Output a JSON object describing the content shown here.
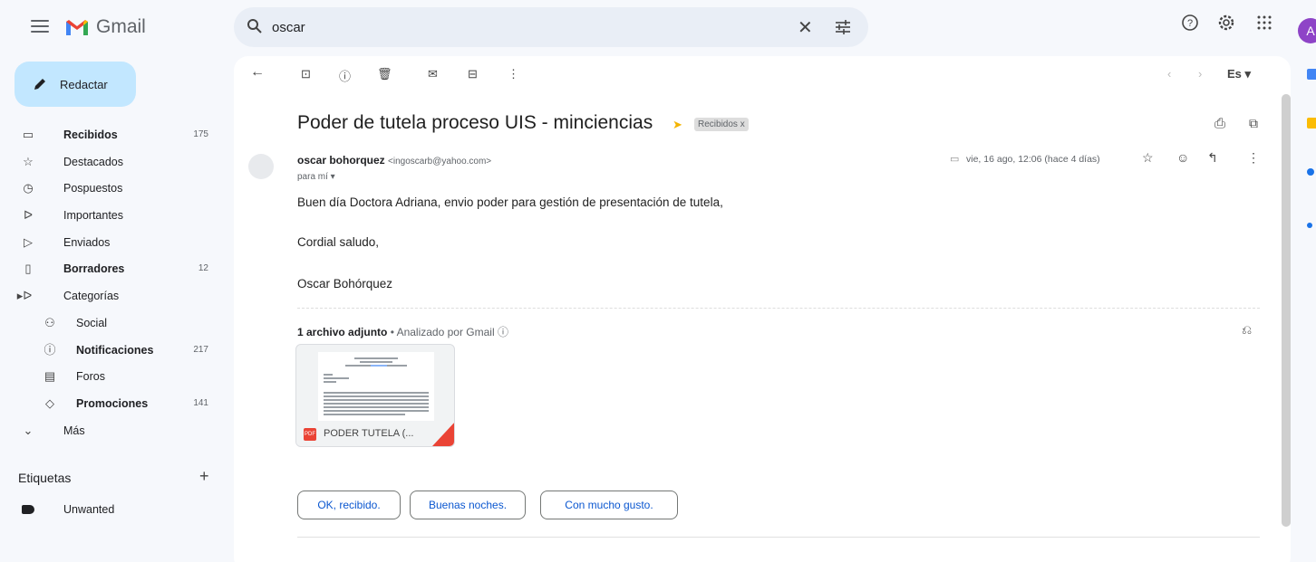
{
  "header": {
    "app_name": "Gmail",
    "search_value": "oscar",
    "avatar_letter": "A"
  },
  "compose_label": "Redactar",
  "sidebar": {
    "items": [
      {
        "label": "Recibidos",
        "count": "175",
        "icon": "inbox-icon",
        "bold": true
      },
      {
        "label": "Destacados",
        "count": "",
        "icon": "star-icon",
        "bold": false
      },
      {
        "label": "Pospuestos",
        "count": "",
        "icon": "clock-icon",
        "bold": false
      },
      {
        "label": "Importantes",
        "count": "",
        "icon": "important-icon",
        "bold": false
      },
      {
        "label": "Enviados",
        "count": "",
        "icon": "send-icon",
        "bold": false
      },
      {
        "label": "Borradores",
        "count": "12",
        "icon": "draft-icon",
        "bold": true
      },
      {
        "label": "Categorías",
        "count": "",
        "icon": "label-icon",
        "bold": false
      },
      {
        "label": "Social",
        "count": "",
        "icon": "people-icon",
        "bold": false
      },
      {
        "label": "Notificaciones",
        "count": "217",
        "icon": "info-icon",
        "bold": true
      },
      {
        "label": "Foros",
        "count": "",
        "icon": "forum-icon",
        "bold": false
      },
      {
        "label": "Promociones",
        "count": "141",
        "icon": "tag-icon",
        "bold": true
      },
      {
        "label": "Más",
        "count": "",
        "icon": "chevron-down-icon",
        "bold": false
      }
    ],
    "labels_heading": "Etiquetas",
    "labels": [
      {
        "label": "Unwanted"
      }
    ]
  },
  "toolbar": {
    "language": "Es"
  },
  "email": {
    "subject": "Poder de tutela proceso UIS - minciencias",
    "folder_chip": "Recibidos x",
    "sender_name": "oscar bohorquez",
    "sender_email": "<ingoscarb@yahoo.com>",
    "to": "para mí ▾",
    "date": "vie, 16 ago, 12:06 (hace 4 días)",
    "body": [
      "Buen día Doctora Adriana, envio poder para gestión de presentación de tutela,",
      "Cordial saludo,",
      "Oscar Bohórquez"
    ],
    "attachment_header": "1 archivo adjunto",
    "attachment_scan": "• Analizado por Gmail ⓘ",
    "attachment_name": "PODER TUTELA (...",
    "pdf_badge": "PDF"
  },
  "smart_replies": [
    "OK, recibido.",
    "Buenas noches.",
    "Con mucho gusto."
  ],
  "colors": {
    "background": "#f6f8fc",
    "compose": "#c2e7ff",
    "search": "#e9eef6",
    "accent_blue": "#0b57d0",
    "pdf_red": "#ea4335"
  }
}
